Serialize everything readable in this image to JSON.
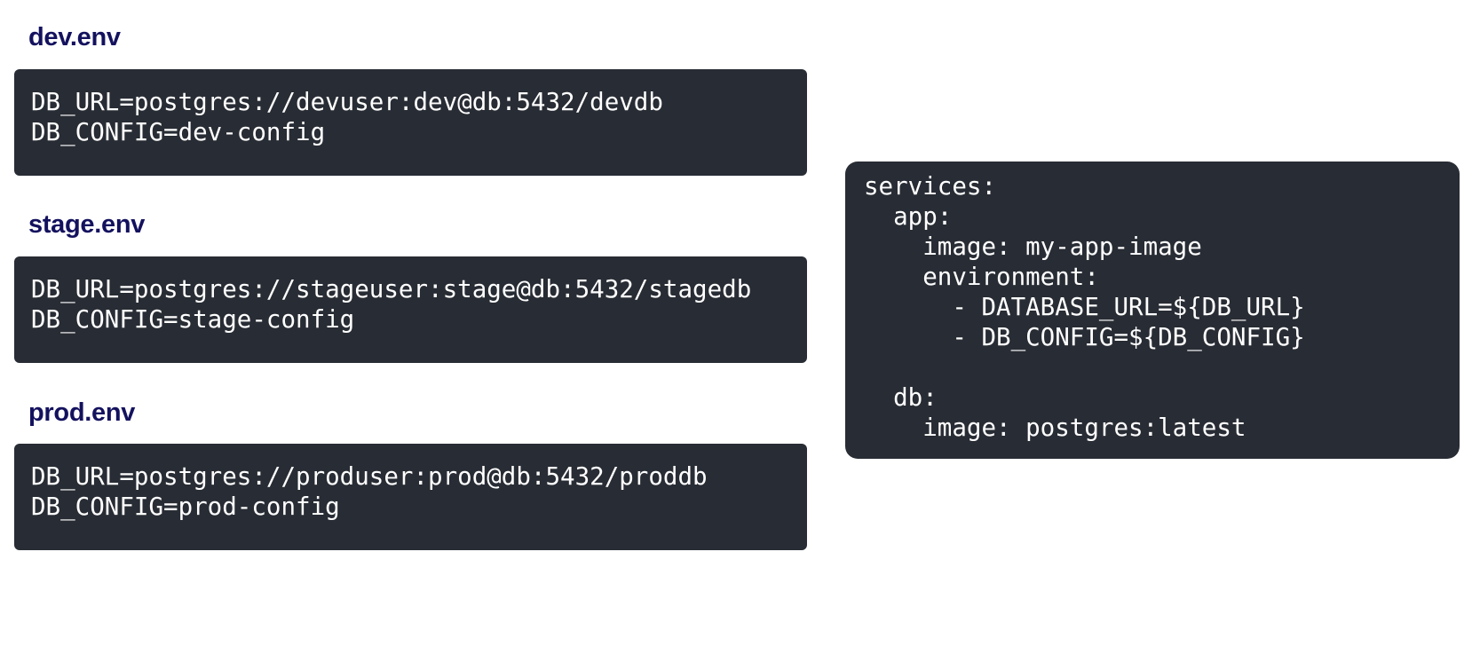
{
  "env_files": [
    {
      "title": "dev.env",
      "lines": [
        "DB_URL=postgres://devuser:dev@db:5432/devdb",
        "DB_CONFIG=dev-config"
      ]
    },
    {
      "title": "stage.env",
      "lines": [
        "DB_URL=postgres://stageuser:stage@db:5432/stagedb",
        "DB_CONFIG=stage-config"
      ]
    },
    {
      "title": "prod.env",
      "lines": [
        "DB_URL=postgres://produser:prod@db:5432/proddb",
        "DB_CONFIG=prod-config"
      ]
    }
  ],
  "compose": {
    "lines": [
      "services:",
      "  app:",
      "    image: my-app-image",
      "    environment:",
      "      - DATABASE_URL=${DB_URL}",
      "      - DB_CONFIG=${DB_CONFIG}",
      "",
      "  db:",
      "    image: postgres:latest"
    ]
  }
}
